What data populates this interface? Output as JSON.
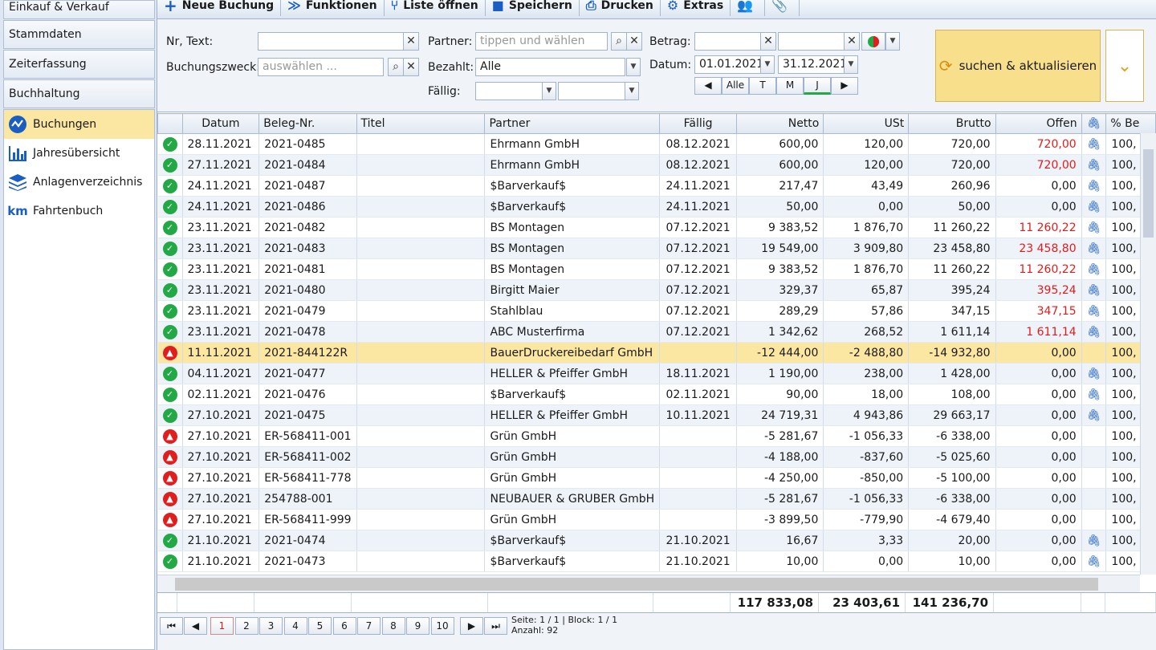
{
  "sidebar": {
    "sections": [
      "Einkauf & Verkauf",
      "Stammdaten",
      "Zeiterfassung",
      "Buchhaltung"
    ],
    "items": [
      {
        "label": "Buchungen",
        "icon": "buchungen-icon"
      },
      {
        "label": "Jahresübersicht",
        "icon": "bar-chart-icon"
      },
      {
        "label": "Anlagenverzeichnis",
        "icon": "layers-icon"
      },
      {
        "label": "Fahrtenbuch",
        "icon": "km-icon",
        "icon_text": "km"
      }
    ]
  },
  "toolbar": {
    "items": [
      {
        "label": "Neue Buchung",
        "icon": "plus-icon"
      },
      {
        "label": "Funktionen",
        "icon": "double-chevron-icon"
      },
      {
        "label": "Liste öffnen",
        "icon": "fork-icon"
      },
      {
        "label": "Speichern",
        "icon": "save-icon"
      },
      {
        "label": "Drucken",
        "icon": "print-icon"
      },
      {
        "label": "Extras",
        "icon": "gear-icon"
      }
    ]
  },
  "filter": {
    "nr_text_label": "Nr, Text:",
    "nr_text_value": "",
    "zweck_label": "Buchungszweck:",
    "zweck_placeholder": "auswählen ...",
    "partner_label": "Partner:",
    "partner_placeholder": "tippen und wählen",
    "bezahlt_label": "Bezahlt:",
    "bezahlt_value": "Alle",
    "faellig_label": "Fällig:",
    "betrag_label": "Betrag:",
    "datum_label": "Datum:",
    "datum_from": "01.01.2021",
    "datum_to": "31.12.2021",
    "periods": [
      "Alle",
      "T",
      "M",
      "J"
    ],
    "search_label": "suchen & aktualisieren"
  },
  "grid": {
    "columns": [
      "Datum",
      "Beleg-Nr.",
      "Titel",
      "Partner",
      "Fällig",
      "Netto",
      "USt",
      "Brutto",
      "Offen",
      "",
      "% Be"
    ],
    "rows": [
      {
        "s": "ok",
        "d": "28.11.2021",
        "n": "2021-0485",
        "t": "",
        "p": "Ehrmann GmbH",
        "f": "08.12.2021",
        "ne": "600,00",
        "u": "120,00",
        "b": "720,00",
        "o": "720,00",
        "or": true,
        "a": true,
        "pc": "100,"
      },
      {
        "s": "ok",
        "d": "27.11.2021",
        "n": "2021-0484",
        "t": "",
        "p": "Ehrmann GmbH",
        "f": "08.12.2021",
        "ne": "600,00",
        "u": "120,00",
        "b": "720,00",
        "o": "720,00",
        "or": true,
        "a": true,
        "pc": "100,"
      },
      {
        "s": "ok",
        "d": "24.11.2021",
        "n": "2021-0487",
        "t": "",
        "p": "$Barverkauf$",
        "f": "24.11.2021",
        "ne": "217,47",
        "u": "43,49",
        "b": "260,96",
        "o": "0,00",
        "or": false,
        "a": true,
        "pc": "100,"
      },
      {
        "s": "ok",
        "d": "24.11.2021",
        "n": "2021-0486",
        "t": "",
        "p": "$Barverkauf$",
        "f": "24.11.2021",
        "ne": "50,00",
        "u": "0,00",
        "b": "50,00",
        "o": "0,00",
        "or": false,
        "a": true,
        "pc": "100,"
      },
      {
        "s": "ok",
        "d": "23.11.2021",
        "n": "2021-0482",
        "t": "",
        "p": "BS Montagen",
        "f": "07.12.2021",
        "ne": "9 383,52",
        "u": "1 876,70",
        "b": "11 260,22",
        "o": "11 260,22",
        "or": true,
        "a": true,
        "pc": "100,"
      },
      {
        "s": "ok",
        "d": "23.11.2021",
        "n": "2021-0483",
        "t": "",
        "p": "BS Montagen",
        "f": "07.12.2021",
        "ne": "19 549,00",
        "u": "3 909,80",
        "b": "23 458,80",
        "o": "23 458,80",
        "or": true,
        "a": true,
        "pc": "100,"
      },
      {
        "s": "ok",
        "d": "23.11.2021",
        "n": "2021-0481",
        "t": "",
        "p": "BS Montagen",
        "f": "07.12.2021",
        "ne": "9 383,52",
        "u": "1 876,70",
        "b": "11 260,22",
        "o": "11 260,22",
        "or": true,
        "a": true,
        "pc": "100,"
      },
      {
        "s": "ok",
        "d": "23.11.2021",
        "n": "2021-0480",
        "t": "",
        "p": "Birgitt Maier",
        "f": "07.12.2021",
        "ne": "329,37",
        "u": "65,87",
        "b": "395,24",
        "o": "395,24",
        "or": true,
        "a": true,
        "pc": "100,"
      },
      {
        "s": "ok",
        "d": "23.11.2021",
        "n": "2021-0479",
        "t": "",
        "p": "Stahlblau",
        "f": "07.12.2021",
        "ne": "289,29",
        "u": "57,86",
        "b": "347,15",
        "o": "347,15",
        "or": true,
        "a": true,
        "pc": "100,"
      },
      {
        "s": "ok",
        "d": "23.11.2021",
        "n": "2021-0478",
        "t": "",
        "p": "ABC Musterfirma",
        "f": "07.12.2021",
        "ne": "1 342,62",
        "u": "268,52",
        "b": "1 611,14",
        "o": "1 611,14",
        "or": true,
        "a": true,
        "pc": "100,"
      },
      {
        "s": "up",
        "d": "11.11.2021",
        "n": "2021-844122R",
        "t": "",
        "p": "BauerDruckereibedarf GmbH",
        "f": "",
        "ne": "-12 444,00",
        "u": "-2 488,80",
        "b": "-14 932,80",
        "o": "0,00",
        "or": false,
        "a": false,
        "pc": "100,",
        "sel": true
      },
      {
        "s": "ok",
        "d": "04.11.2021",
        "n": "2021-0477",
        "t": "",
        "p": "HELLER & Pfeiffer GmbH",
        "f": "18.11.2021",
        "ne": "1 190,00",
        "u": "238,00",
        "b": "1 428,00",
        "o": "0,00",
        "or": false,
        "a": true,
        "pc": "100,"
      },
      {
        "s": "ok",
        "d": "02.11.2021",
        "n": "2021-0476",
        "t": "",
        "p": "$Barverkauf$",
        "f": "02.11.2021",
        "ne": "90,00",
        "u": "18,00",
        "b": "108,00",
        "o": "0,00",
        "or": false,
        "a": true,
        "pc": "100,"
      },
      {
        "s": "ok",
        "d": "27.10.2021",
        "n": "2021-0475",
        "t": "",
        "p": "HELLER & Pfeiffer GmbH",
        "f": "10.11.2021",
        "ne": "24 719,31",
        "u": "4 943,86",
        "b": "29 663,17",
        "o": "0,00",
        "or": false,
        "a": true,
        "pc": "100,"
      },
      {
        "s": "up",
        "d": "27.10.2021",
        "n": "ER-568411-001",
        "t": "",
        "p": "Grün GmbH",
        "f": "",
        "ne": "-5 281,67",
        "u": "-1 056,33",
        "b": "-6 338,00",
        "o": "0,00",
        "or": false,
        "a": false,
        "pc": "100,"
      },
      {
        "s": "up",
        "d": "27.10.2021",
        "n": "ER-568411-002",
        "t": "",
        "p": "Grün GmbH",
        "f": "",
        "ne": "-4 188,00",
        "u": "-837,60",
        "b": "-5 025,60",
        "o": "0,00",
        "or": false,
        "a": false,
        "pc": "100,"
      },
      {
        "s": "up",
        "d": "27.10.2021",
        "n": "ER-568411-778",
        "t": "",
        "p": "Grün GmbH",
        "f": "",
        "ne": "-4 250,00",
        "u": "-850,00",
        "b": "-5 100,00",
        "o": "0,00",
        "or": false,
        "a": false,
        "pc": "100,"
      },
      {
        "s": "up",
        "d": "27.10.2021",
        "n": "254788-001",
        "t": "",
        "p": "NEUBAUER & GRUBER GmbH",
        "f": "",
        "ne": "-5 281,67",
        "u": "-1 056,33",
        "b": "-6 338,00",
        "o": "0,00",
        "or": false,
        "a": false,
        "pc": "100,"
      },
      {
        "s": "up",
        "d": "27.10.2021",
        "n": "ER-568411-999",
        "t": "",
        "p": "Grün GmbH",
        "f": "",
        "ne": "-3 899,50",
        "u": "-779,90",
        "b": "-4 679,40",
        "o": "0,00",
        "or": false,
        "a": false,
        "pc": "100,"
      },
      {
        "s": "ok",
        "d": "21.10.2021",
        "n": "2021-0474",
        "t": "",
        "p": "$Barverkauf$",
        "f": "21.10.2021",
        "ne": "16,67",
        "u": "3,33",
        "b": "20,00",
        "o": "0,00",
        "or": false,
        "a": true,
        "pc": "100,"
      },
      {
        "s": "ok",
        "d": "21.10.2021",
        "n": "2021-0473",
        "t": "",
        "p": "$Barverkauf$",
        "f": "21.10.2021",
        "ne": "10,00",
        "u": "0,00",
        "b": "10,00",
        "o": "0,00",
        "or": false,
        "a": true,
        "pc": "100,"
      }
    ]
  },
  "totals": {
    "netto": "117 833,08",
    "ust": "23 403,61",
    "brutto": "141 236,70"
  },
  "pager": {
    "pages": [
      "1",
      "2",
      "3",
      "4",
      "5",
      "6",
      "7",
      "8",
      "9",
      "10"
    ],
    "current": "1",
    "info1": "Seite: 1 / 1 | Block: 1 / 1",
    "info2": "Anzahl: 92"
  },
  "colors": {
    "accent": "#fbe7a1",
    "ok": "#22a845",
    "warn": "#e01e1e",
    "link": "#1b5ec1"
  }
}
